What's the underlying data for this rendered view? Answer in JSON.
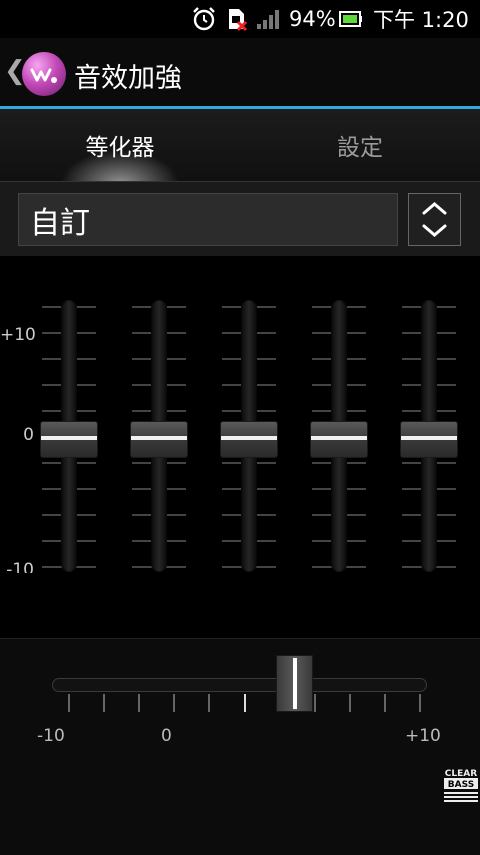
{
  "status_bar": {
    "battery_percent": "94%",
    "time": "下午 1:20",
    "icons": [
      "alarm-icon",
      "sim-error-icon",
      "signal-icon",
      "battery-icon"
    ]
  },
  "action_bar": {
    "back_glyph": "❮",
    "title": "音效加強"
  },
  "tabs": [
    {
      "label": "等化器",
      "active": true
    },
    {
      "label": "設定",
      "active": false
    }
  ],
  "preset": {
    "value": "自訂"
  },
  "equalizer": {
    "scale_labels": {
      "max": "+10",
      "zero": "0",
      "min": "-10"
    },
    "bands": [
      {
        "level": 0
      },
      {
        "level": 0
      },
      {
        "level": 0
      },
      {
        "level": 0
      },
      {
        "level": 0
      }
    ]
  },
  "clear_bass": {
    "labels": {
      "min": "-10",
      "zero": "0",
      "max": "+10"
    },
    "level": 5,
    "logo_top": "CLEAR",
    "logo_bottom": "BASS"
  },
  "colors": {
    "accent": "#33aadd",
    "background": "#000000"
  }
}
